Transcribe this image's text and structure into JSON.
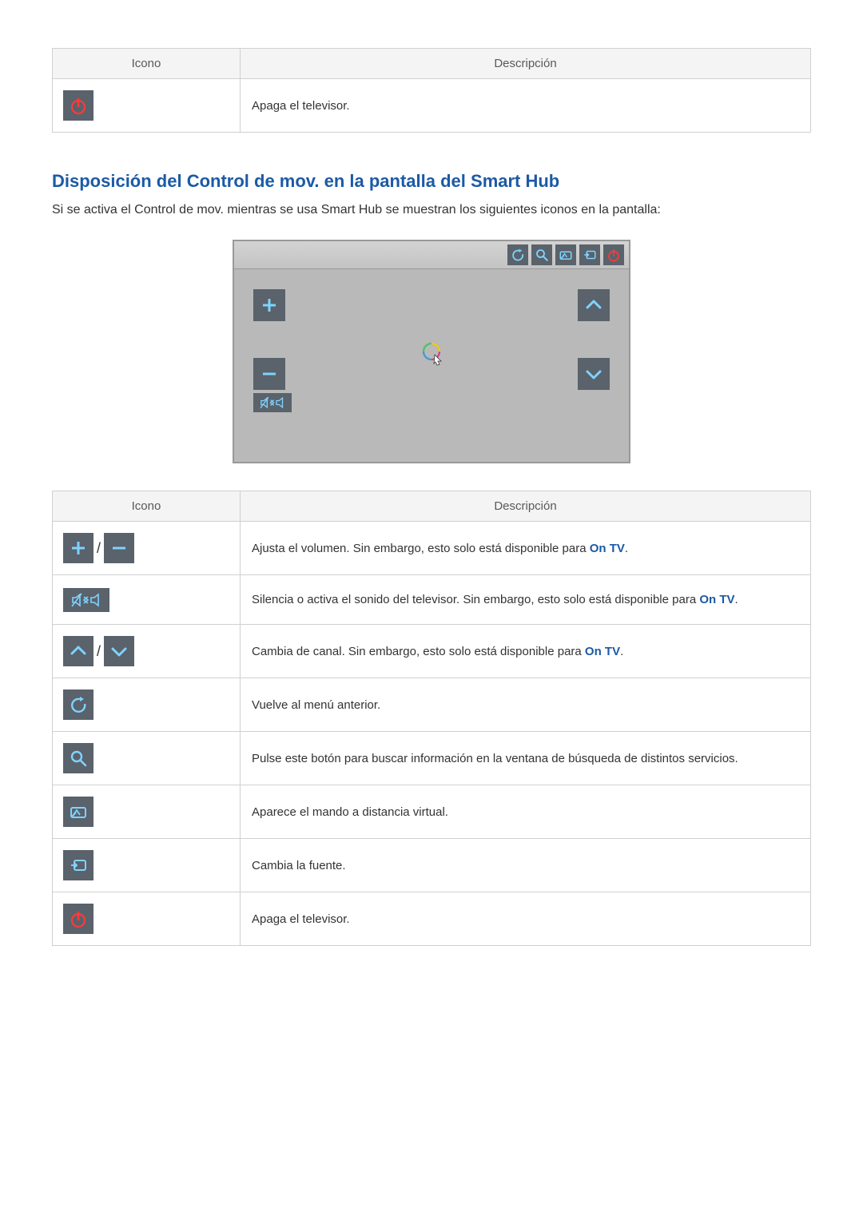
{
  "table1": {
    "headers": {
      "icon": "Icono",
      "desc": "Descripción"
    },
    "rows": [
      {
        "icon": "power",
        "desc": "Apaga el televisor."
      }
    ]
  },
  "section": {
    "title": "Disposición del Control de mov. en la pantalla del Smart Hub",
    "body": "Si se activa el Control de mov. mientras se usa Smart Hub se muestran los siguientes iconos en la pantalla:"
  },
  "table2": {
    "headers": {
      "icon": "Icono",
      "desc": "Descripción"
    },
    "rows": [
      {
        "icon": "vol",
        "desc_a": "Ajusta el volumen. Sin embargo, esto solo está disponible para ",
        "link": "On TV",
        "desc_b": "."
      },
      {
        "icon": "mute",
        "desc_a": "Silencia o activa el sonido del televisor. Sin embargo, esto solo está disponible para ",
        "link": "On TV",
        "desc_b": "."
      },
      {
        "icon": "ch",
        "desc_a": "Cambia de canal. Sin embargo, esto solo está disponible para ",
        "link": "On TV",
        "desc_b": "."
      },
      {
        "icon": "back",
        "desc_a": "Vuelve al menú anterior.",
        "link": "",
        "desc_b": ""
      },
      {
        "icon": "search",
        "desc_a": "Pulse este botón para buscar información en la ventana de búsqueda de distintos servicios.",
        "link": "",
        "desc_b": ""
      },
      {
        "icon": "remote",
        "desc_a": "Aparece el mando a distancia virtual.",
        "link": "",
        "desc_b": ""
      },
      {
        "icon": "source",
        "desc_a": "Cambia la fuente.",
        "link": "",
        "desc_b": ""
      },
      {
        "icon": "power",
        "desc_a": "Apaga el televisor.",
        "link": "",
        "desc_b": ""
      }
    ]
  }
}
